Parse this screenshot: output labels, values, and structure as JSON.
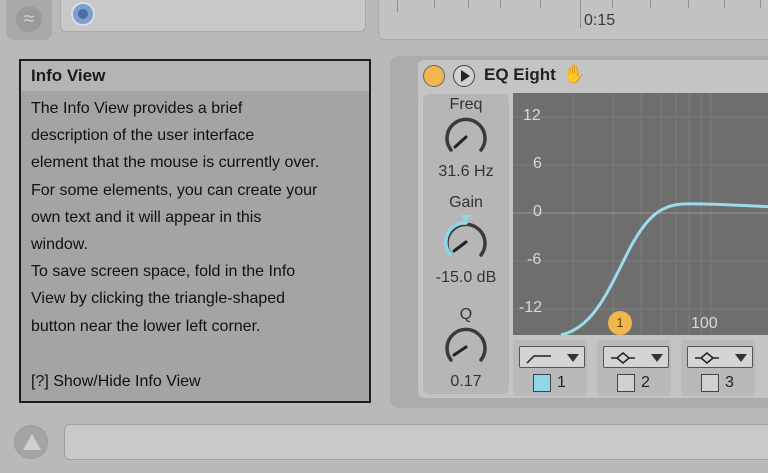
{
  "timeline": {
    "time_label": "0:15"
  },
  "info_view": {
    "title": "Info View",
    "body": "The Info View provides a brief\ndescription of the user interface\nelement that the mouse is currently over.\nFor some elements, you can create your\nown text and it will appear in this\nwindow.\nTo save screen space, fold in the Info\nView by clicking the triangle-shaped\nbutton near the lower left corner.",
    "footer": "[?] Show/Hide Info View"
  },
  "device": {
    "title": "EQ Eight",
    "accent_color": "#f0b84c",
    "curve_color": "#9bdcec",
    "knobs": [
      {
        "label": "Freq",
        "value": "31.6 Hz"
      },
      {
        "label": "Gain",
        "value": "-15.0 dB"
      },
      {
        "label": "Q",
        "value": "0.17"
      }
    ],
    "graph": {
      "y_labels": [
        "12",
        "6",
        "0",
        "-6",
        "-12"
      ],
      "x_label": "100",
      "band_marker": "1"
    },
    "filters": [
      {
        "shape_icon": "low-cut-icon",
        "number": "1",
        "active": true
      },
      {
        "shape_icon": "bell-icon",
        "number": "2",
        "active": false
      },
      {
        "shape_icon": "bell-icon",
        "number": "3",
        "active": false
      }
    ]
  }
}
